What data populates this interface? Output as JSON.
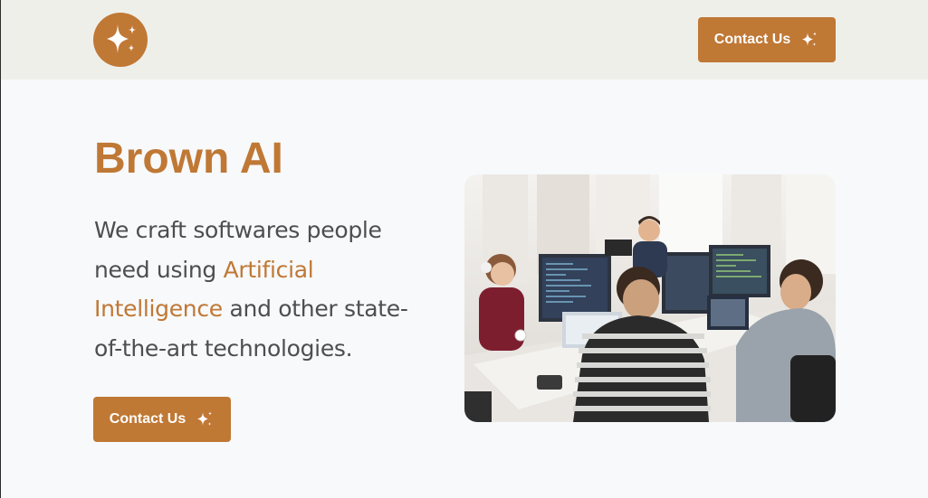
{
  "header": {
    "logo_icon": "sparkle-icon",
    "contact_label": "Contact Us",
    "contact_icon": "sparkle-icon"
  },
  "hero": {
    "title": "Brown AI",
    "tagline_part1": "We craft softwares people need using ",
    "tagline_accent": "Artificial Intelligence",
    "tagline_part2": " and other state-of-the-art technologies.",
    "contact_label": "Contact Us",
    "contact_icon": "sparkle-icon",
    "image_icon": "office-team-photo"
  },
  "colors": {
    "accent": "#c07835",
    "header_bg": "#efefe9",
    "page_bg": "#f7f9fb",
    "text": "#4e4e4e"
  }
}
